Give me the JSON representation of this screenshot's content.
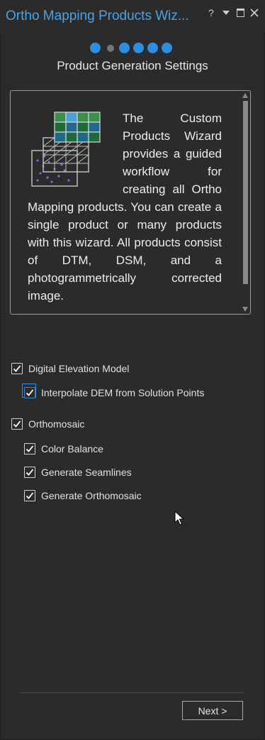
{
  "window": {
    "title": "Ortho Mapping Products Wiz...",
    "help_label": "?"
  },
  "steps": {
    "total": 6,
    "current": 2
  },
  "step_title": "Product Generation Settings",
  "description": "The Custom Products Wizard provides a guided workflow for creating all Ortho Mapping products. You can create a single product or many products with this wizard. All products consist of DTM, DSM, and a photogrammetrically corrected image.",
  "options": [
    {
      "label": "Digital Elevation Model",
      "checked": true
    },
    {
      "label": "Interpolate DEM from Solution Points",
      "checked": true
    },
    {
      "label": "Orthomosaic",
      "checked": true
    },
    {
      "label": "Color Balance",
      "checked": true
    },
    {
      "label": "Generate Seamlines",
      "checked": true
    },
    {
      "label": "Generate Orthomosaic",
      "checked": true
    }
  ],
  "footer": {
    "next_label": "Next >"
  },
  "colors": {
    "background": "#2b2b2b",
    "accent": "#2e8fe0",
    "title": "#4aa3e8"
  }
}
